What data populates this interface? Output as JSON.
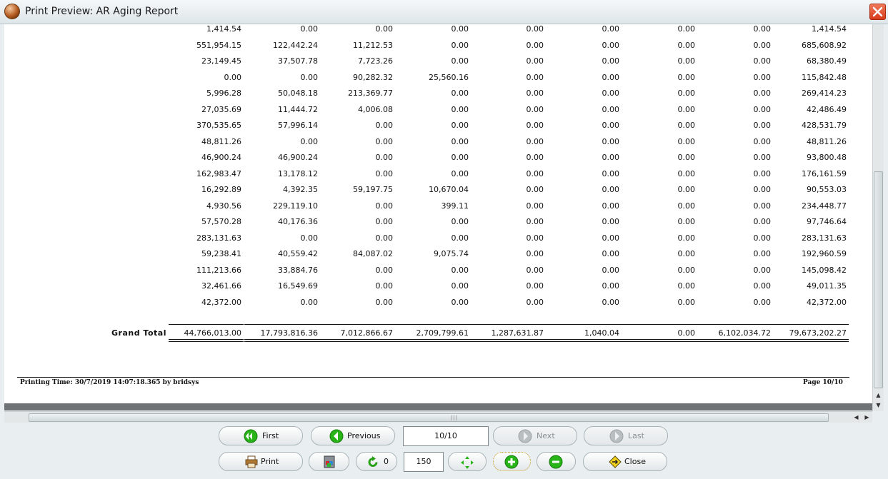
{
  "window": {
    "title": "Print Preview: AR Aging Report"
  },
  "report": {
    "rows": [
      [
        "1,414.54",
        "0.00",
        "0.00",
        "0.00",
        "0.00",
        "0.00",
        "0.00",
        "0.00",
        "1,414.54"
      ],
      [
        "551,954.15",
        "122,442.24",
        "11,212.53",
        "0.00",
        "0.00",
        "0.00",
        "0.00",
        "0.00",
        "685,608.92"
      ],
      [
        "23,149.45",
        "37,507.78",
        "7,723.26",
        "0.00",
        "0.00",
        "0.00",
        "0.00",
        "0.00",
        "68,380.49"
      ],
      [
        "0.00",
        "0.00",
        "90,282.32",
        "25,560.16",
        "0.00",
        "0.00",
        "0.00",
        "0.00",
        "115,842.48"
      ],
      [
        "5,996.28",
        "50,048.18",
        "213,369.77",
        "0.00",
        "0.00",
        "0.00",
        "0.00",
        "0.00",
        "269,414.23"
      ],
      [
        "27,035.69",
        "11,444.72",
        "4,006.08",
        "0.00",
        "0.00",
        "0.00",
        "0.00",
        "0.00",
        "42,486.49"
      ],
      [
        "370,535.65",
        "57,996.14",
        "0.00",
        "0.00",
        "0.00",
        "0.00",
        "0.00",
        "0.00",
        "428,531.79"
      ],
      [
        "48,811.26",
        "0.00",
        "0.00",
        "0.00",
        "0.00",
        "0.00",
        "0.00",
        "0.00",
        "48,811.26"
      ],
      [
        "46,900.24",
        "46,900.24",
        "0.00",
        "0.00",
        "0.00",
        "0.00",
        "0.00",
        "0.00",
        "93,800.48"
      ],
      [
        "162,983.47",
        "13,178.12",
        "0.00",
        "0.00",
        "0.00",
        "0.00",
        "0.00",
        "0.00",
        "176,161.59"
      ],
      [
        "16,292.89",
        "4,392.35",
        "59,197.75",
        "10,670.04",
        "0.00",
        "0.00",
        "0.00",
        "0.00",
        "90,553.03"
      ],
      [
        "4,930.56",
        "229,119.10",
        "0.00",
        "399.11",
        "0.00",
        "0.00",
        "0.00",
        "0.00",
        "234,448.77"
      ],
      [
        "57,570.28",
        "40,176.36",
        "0.00",
        "0.00",
        "0.00",
        "0.00",
        "0.00",
        "0.00",
        "97,746.64"
      ],
      [
        "283,131.63",
        "0.00",
        "0.00",
        "0.00",
        "0.00",
        "0.00",
        "0.00",
        "0.00",
        "283,131.63"
      ],
      [
        "59,238.41",
        "40,559.42",
        "84,087.02",
        "9,075.74",
        "0.00",
        "0.00",
        "0.00",
        "0.00",
        "192,960.59"
      ],
      [
        "111,213.66",
        "33,884.76",
        "0.00",
        "0.00",
        "0.00",
        "0.00",
        "0.00",
        "0.00",
        "145,098.42"
      ],
      [
        "32,461.66",
        "16,549.69",
        "0.00",
        "0.00",
        "0.00",
        "0.00",
        "0.00",
        "0.00",
        "49,011.35"
      ],
      [
        "42,372.00",
        "0.00",
        "0.00",
        "0.00",
        "0.00",
        "0.00",
        "0.00",
        "0.00",
        "42,372.00"
      ]
    ],
    "grand_total_label": "Grand Total",
    "grand_total": [
      "44,766,013.00",
      "17,793,816.36",
      "7,012,866.67",
      "2,709,799.61",
      "1,287,631.87",
      "1,040.04",
      "0.00",
      "6,102,034.72",
      "79,673,202.27"
    ],
    "printing_time": "Printing Time: 30/7/2019 14:07:18.365 by bridsys",
    "page_label": "Page 10/10"
  },
  "toolbar": {
    "first_label": "First",
    "previous_label": "Previous",
    "page_indicator": "10/10",
    "next_label": "Next",
    "last_label": "Last",
    "print_label": "Print",
    "rotate_value": "0",
    "zoom_value": "150",
    "close_label": "Close"
  },
  "colors": {
    "green_icon": "#28b418",
    "accent": "#d63a1a"
  }
}
